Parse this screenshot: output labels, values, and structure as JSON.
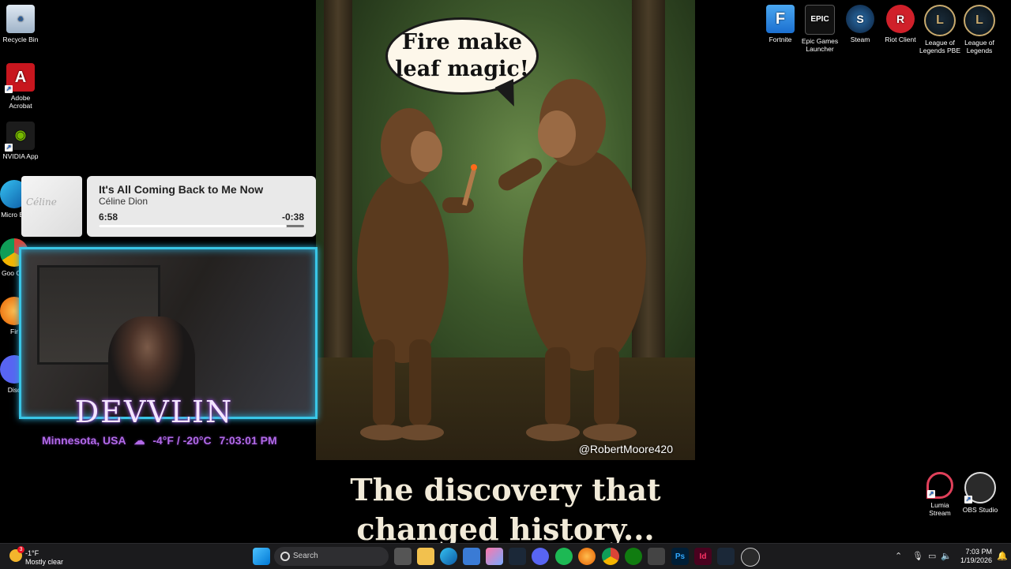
{
  "desktop_left_icons": [
    {
      "name": "recycle-bin",
      "label": "Recycle Bin",
      "icon": "recycle-bin-icon"
    },
    {
      "name": "adobe-acrobat",
      "label": "Adobe Acrobat",
      "icon": "acrobat-icon"
    },
    {
      "name": "nvidia-app",
      "label": "NVIDIA App",
      "icon": "nvidia-icon"
    },
    {
      "name": "microsoft-edge",
      "label": "Micro Ed",
      "icon": "edge-icon"
    },
    {
      "name": "google-chrome",
      "label": "Goo Chr",
      "icon": "chrome-icon"
    },
    {
      "name": "firefox",
      "label": "Fir",
      "icon": "firefox-icon"
    },
    {
      "name": "discord",
      "label": "Disc",
      "icon": "discord-icon"
    }
  ],
  "desktop_top_icons": [
    {
      "name": "fortnite",
      "label": "Fortnite",
      "glyph": "F"
    },
    {
      "name": "epic-games",
      "label": "Epic Games Launcher",
      "glyph": "EPIC"
    },
    {
      "name": "steam",
      "label": "Steam",
      "glyph": "S"
    },
    {
      "name": "riot-client",
      "label": "Riot Client",
      "glyph": "R"
    },
    {
      "name": "league-pbe",
      "label": "League of Legends PBE",
      "glyph": "L"
    },
    {
      "name": "league",
      "label": "League of Legends",
      "glyph": "L"
    }
  ],
  "desktop_bottom_right_icons": [
    {
      "name": "lumia-stream",
      "label": "Lumia Stream"
    },
    {
      "name": "obs-studio",
      "label": "OBS Studio"
    }
  ],
  "meme": {
    "speech_line1": "Fire make",
    "speech_line2": "leaf magic!",
    "watermark": "@RobertMoore420",
    "caption_line1": "The discovery that",
    "caption_line2": "changed history..."
  },
  "media": {
    "title": "It's All Coming Back to Me Now",
    "artist": "Céline Dion",
    "elapsed": "6:58",
    "remaining": "-0:38",
    "progress_fraction": 0.916,
    "album_text": "Céline"
  },
  "overlay": {
    "streamer": "DEVVLIN",
    "location": "Minnesota, USA",
    "weather_icon": "☁",
    "temperature": "-4°F / -20°C",
    "time": "7:03:01 PM"
  },
  "taskbar": {
    "weather_temp": "-1°F",
    "weather_cond": "Mostly clear",
    "weather_badge": "3",
    "search_placeholder": "Search",
    "clock_time": "7:03 PM",
    "clock_date": "1/19/2026"
  },
  "colors": {
    "accent_cyan": "#39c6e6",
    "overlay_purple": "#b26ae8"
  }
}
